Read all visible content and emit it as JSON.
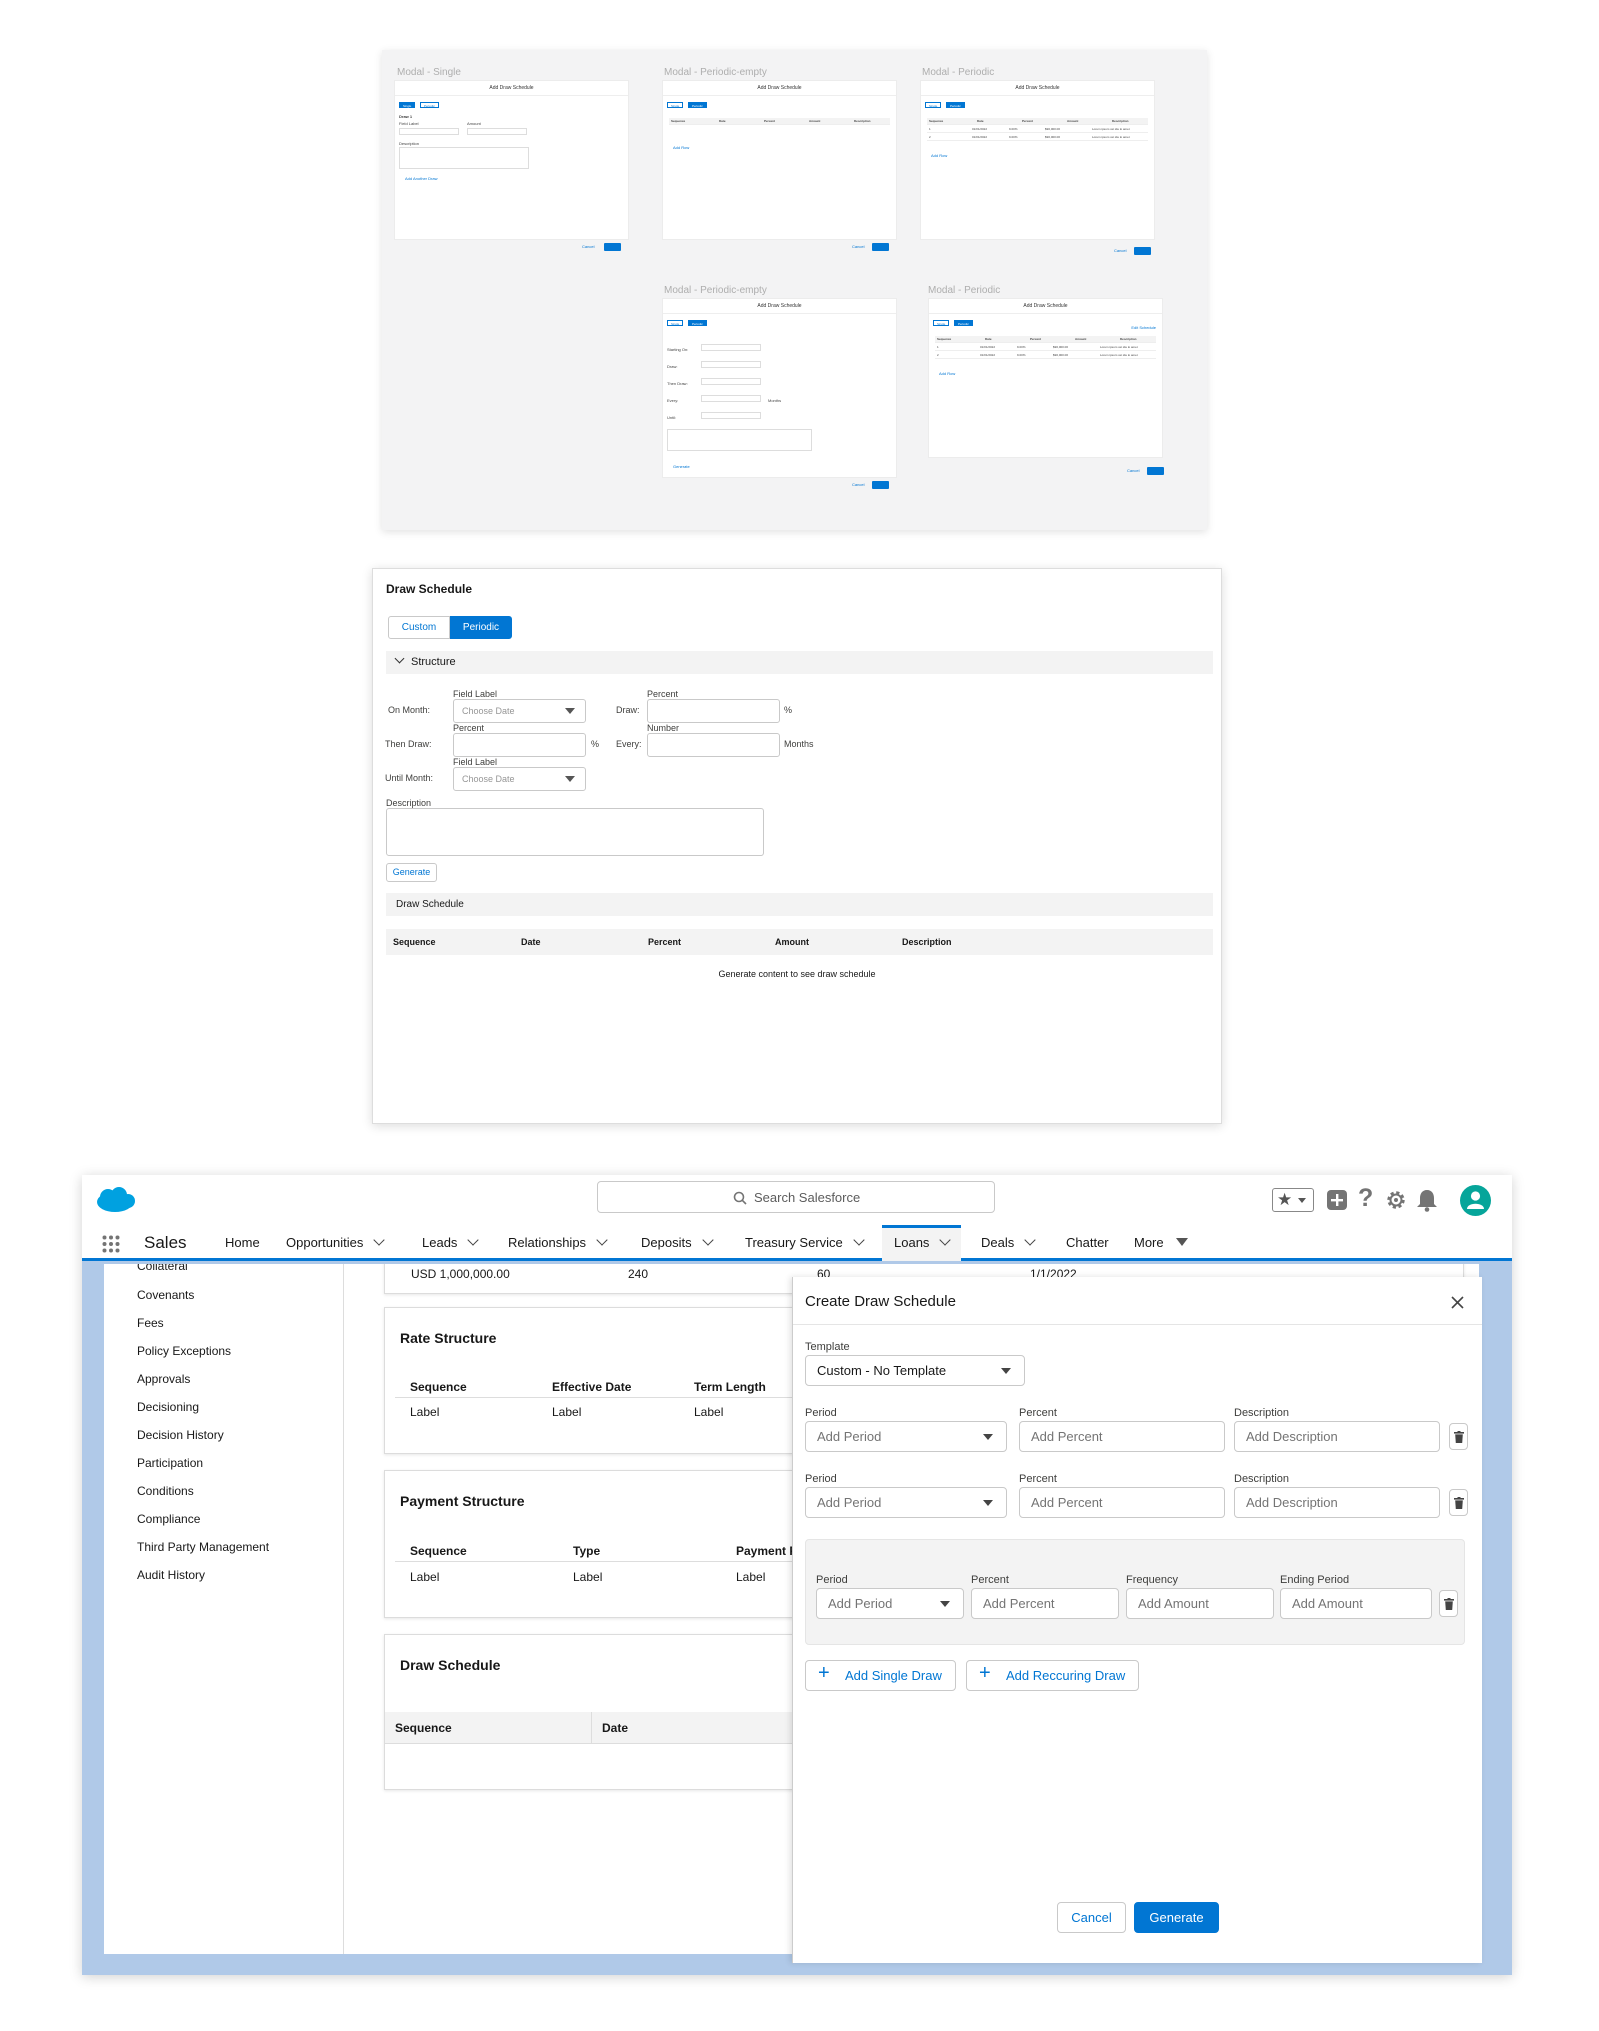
{
  "thumbnails": {
    "labels": [
      "Modal - Single",
      "Modal - Periodic-empty",
      "Modal - Periodic",
      "Modal - Periodic-empty",
      "Modal - Periodic"
    ],
    "modal_title": "Add Draw Schedule",
    "single_tab": "Single",
    "periodic_tab": "Periodic",
    "draw_label": "Draw 1",
    "field_label": "Field Label",
    "amount_label": "Amount",
    "choose_date": "Choose Date",
    "description": "Description",
    "placeholder": "Placeholder",
    "add_another_draw": "Add Another Draw",
    "add_row": "Add Row",
    "cancel": "Cancel",
    "save": "Save",
    "generate": "Generate",
    "edit_schedule": "Edit Schedule",
    "columns": [
      "Sequence",
      "Date",
      "Percent",
      "Amount",
      "Description"
    ],
    "rows": [
      [
        "1",
        "01/01/2022",
        "9.00%",
        "$90,000.00",
        "Lorem ipsum vet ide lo amet"
      ],
      [
        "2",
        "01/01/2022",
        "9.00%",
        "$90,000.00",
        "Lorem ipsum vet ide lo amet"
      ]
    ],
    "periodic_form": [
      "Starting On:",
      "Draw:",
      "Then Draw:",
      "Every:",
      "Until:"
    ],
    "months": "Months"
  },
  "draw_schedule_card": {
    "title": "Draw Schedule",
    "tabs": {
      "custom": "Custom",
      "periodic": "Periodic"
    },
    "structure": "Structure",
    "on_month": "On Month:",
    "then_draw": "Then Draw:",
    "until_month": "Until Month:",
    "draw": "Draw:",
    "every": "Every:",
    "field_label": "Field Label",
    "percent_label": "Percent",
    "number_label": "Number",
    "choose_date": "Choose Date",
    "percent_sign": "%",
    "months": "Months",
    "description_label": "Description",
    "generate_button": "Generate",
    "schedule_section": "Draw Schedule",
    "columns": [
      "Sequence",
      "Date",
      "Percent",
      "Amount",
      "Description"
    ],
    "empty_message": "Generate content to see draw schedule"
  },
  "app": {
    "search_placeholder": "Search Salesforce",
    "app_name": "Sales",
    "nav": [
      "Home",
      "Opportunities",
      "Leads",
      "Relationships",
      "Deposits",
      "Treasury Service",
      "Loans",
      "Deals",
      "Chatter",
      "More"
    ],
    "active_tab": "Loans",
    "left_nav": [
      "Collateral",
      "Covenants",
      "Fees",
      "Policy Exceptions",
      "Approvals",
      "Decisioning",
      "Decision History",
      "Participation",
      "Conditions",
      "Compliance",
      "Third Party Management",
      "Audit History"
    ],
    "top_row": {
      "amount": "USD 1,000,000.00",
      "term": "240",
      "number": "60",
      "date": "1/1/2022"
    },
    "rate_structure": {
      "title": "Rate Structure",
      "columns": [
        "Sequence",
        "Effective Date",
        "Term Length"
      ],
      "row": [
        "Label",
        "Label",
        "Label"
      ]
    },
    "payment_structure": {
      "title": "Payment Structure",
      "columns": [
        "Sequence",
        "Type",
        "Payment Freq"
      ],
      "row": [
        "Label",
        "Label",
        "Label"
      ]
    },
    "draw_schedule": {
      "title": "Draw Schedule",
      "columns": [
        "Sequence",
        "Date"
      ]
    }
  },
  "modal": {
    "title": "Create Draw Schedule",
    "template_label": "Template",
    "template_value": "Custom - No Template",
    "period_label": "Period",
    "percent_label": "Percent",
    "description_label": "Description",
    "frequency_label": "Frequency",
    "ending_period_label": "Ending Period",
    "period_placeholder": "Add Period",
    "percent_placeholder": "Add Percent",
    "description_placeholder": "Add Description",
    "amount_placeholder": "Add Amount",
    "add_single_draw": "Add Single Draw",
    "add_recurring_draw": "Add Reccuring Draw",
    "cancel": "Cancel",
    "generate": "Generate"
  },
  "colors": {
    "brand": "#0176d3",
    "cloud": "#00a1e0",
    "backdrop": "#b0c9e8"
  }
}
